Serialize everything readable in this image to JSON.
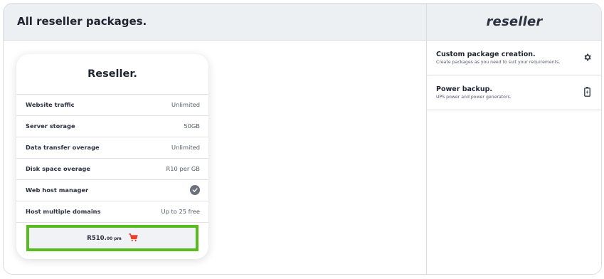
{
  "header": {
    "title": "All reseller packages."
  },
  "sidebar": {
    "brand": "reseller",
    "features": [
      {
        "title": "Custom package creation.",
        "desc": "Create packages as you need to suit your requirements.",
        "icon": "gear-icon"
      },
      {
        "title": "Power backup.",
        "desc": "UPS power and power generators.",
        "icon": "battery-icon"
      }
    ]
  },
  "package": {
    "name": "Reseller.",
    "rows": [
      {
        "label": "Website traffic",
        "value": "Unlimited"
      },
      {
        "label": "Server storage",
        "value": "50GB"
      },
      {
        "label": "Data transfer overage",
        "value": "Unlimited"
      },
      {
        "label": "Disk space overage",
        "value": "R10 per GB"
      },
      {
        "label": "Web host manager",
        "value": "",
        "icon": "check-circle-icon"
      },
      {
        "label": "Host multiple domains",
        "value": "Up to 25 free"
      }
    ],
    "price": {
      "main": "R510.",
      "cents": "00",
      "period": "pm"
    },
    "cart_icon": "cart-icon"
  },
  "colors": {
    "accent": "#58bc1f",
    "cart": "#e8412c",
    "header_bg": "#edf0f3"
  }
}
